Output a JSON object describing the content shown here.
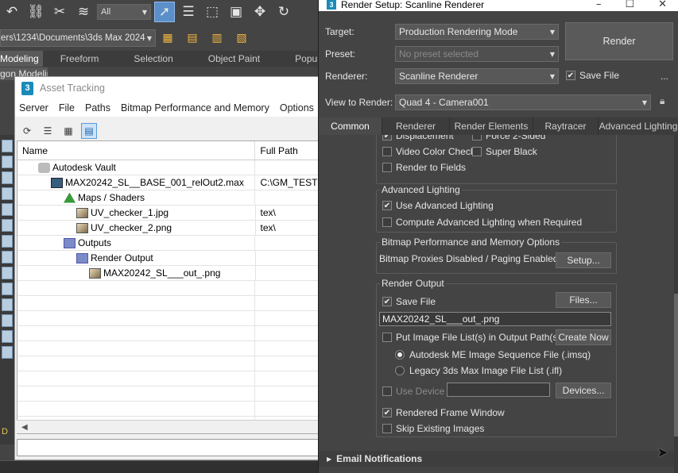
{
  "max": {
    "selection_filter": "All",
    "path_bar": "ers\\1234\\Documents\\3ds Max 2024",
    "ribbon_tabs": [
      "Modeling",
      "Freeform",
      "Selection",
      "Object Paint",
      "Populi"
    ],
    "sub_ribbon": "gon Modeling",
    "dn_label": "D"
  },
  "asset_tracking": {
    "title": "Asset Tracking",
    "menu": [
      "Server",
      "File",
      "Paths",
      "Bitmap Performance and Memory",
      "Options"
    ],
    "columns": [
      "Name",
      "Full Path"
    ],
    "rows": [
      {
        "indent": 26,
        "icon": "vault",
        "name": "Autodesk Vault",
        "path": ""
      },
      {
        "indent": 42,
        "icon": "max",
        "name": "MAX20242_SL__BASE_001_relOut2.max",
        "path": "C:\\GM_TESTS\\"
      },
      {
        "indent": 58,
        "icon": "maps",
        "name": "Maps / Shaders",
        "path": ""
      },
      {
        "indent": 74,
        "icon": "img",
        "name": "UV_checker_1.jpg",
        "path": "tex\\"
      },
      {
        "indent": 74,
        "icon": "img",
        "name": "UV_checker_2.png",
        "path": "tex\\"
      },
      {
        "indent": 58,
        "icon": "folder",
        "name": "Outputs",
        "path": ""
      },
      {
        "indent": 74,
        "icon": "folder",
        "name": "Render Output",
        "path": ""
      },
      {
        "indent": 90,
        "icon": "img",
        "name": "MAX20242_SL___out_.png",
        "path": ""
      }
    ],
    "empty_rows": 10
  },
  "render_setup": {
    "title": "Render Setup: Scanline Renderer",
    "target_label": "Target:",
    "target_value": "Production Rendering Mode",
    "preset_label": "Preset:",
    "preset_value": "No preset selected",
    "renderer_label": "Renderer:",
    "renderer_value": "Scanline Renderer",
    "view_label": "View to Render:",
    "view_value": "Quad 4 - Camera001",
    "render_button": "Render",
    "save_file_top": "Save File",
    "more": "...",
    "tabs": [
      "Common",
      "Renderer",
      "Render Elements",
      "Raytracer",
      "Advanced Lighting"
    ],
    "options_top": {
      "displacement": "Displacement",
      "force_2_sided": "Force 2-Sided",
      "video_color_check": "Video Color Check",
      "super_black": "Super Black",
      "render_to_fields": "Render to Fields"
    },
    "advanced_lighting": {
      "title": "Advanced Lighting",
      "use": "Use Advanced Lighting",
      "compute": "Compute Advanced Lighting when Required"
    },
    "bitmap": {
      "title": "Bitmap Performance and Memory Options",
      "status": "Bitmap Proxies Disabled / Paging Enabled",
      "setup_button": "Setup..."
    },
    "render_output": {
      "title": "Render Output",
      "save_file": "Save File",
      "files_button": "Files...",
      "filename": "MAX20242_SL___out_.png",
      "put_image_list": "Put Image File List(s) in Output Path(s)",
      "create_now": "Create Now",
      "imsq": "Autodesk ME Image Sequence File (.imsq)",
      "ifl": "Legacy 3ds Max Image File List (.ifl)",
      "use_device": "Use Device",
      "devices_button": "Devices...",
      "rendered_frame_window": "Rendered Frame Window",
      "skip_existing": "Skip Existing Images"
    },
    "email": "Email Notifications"
  }
}
